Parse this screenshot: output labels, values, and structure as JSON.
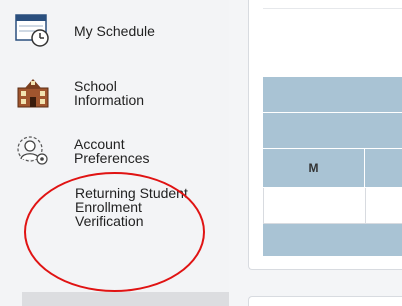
{
  "sidebar": {
    "items": [
      {
        "label": "My Schedule",
        "icon": "calendar-clock-icon"
      },
      {
        "label": "School Information",
        "icon": "school-building-icon"
      },
      {
        "label": "Account Preferences",
        "icon": "user-gear-icon"
      },
      {
        "label": "Returning Student Enrollment Verification"
      }
    ]
  },
  "schedule_table": {
    "day_header": "M"
  },
  "colors": {
    "table_header": "#a9c3d4",
    "highlight_circle": "#e01313"
  }
}
